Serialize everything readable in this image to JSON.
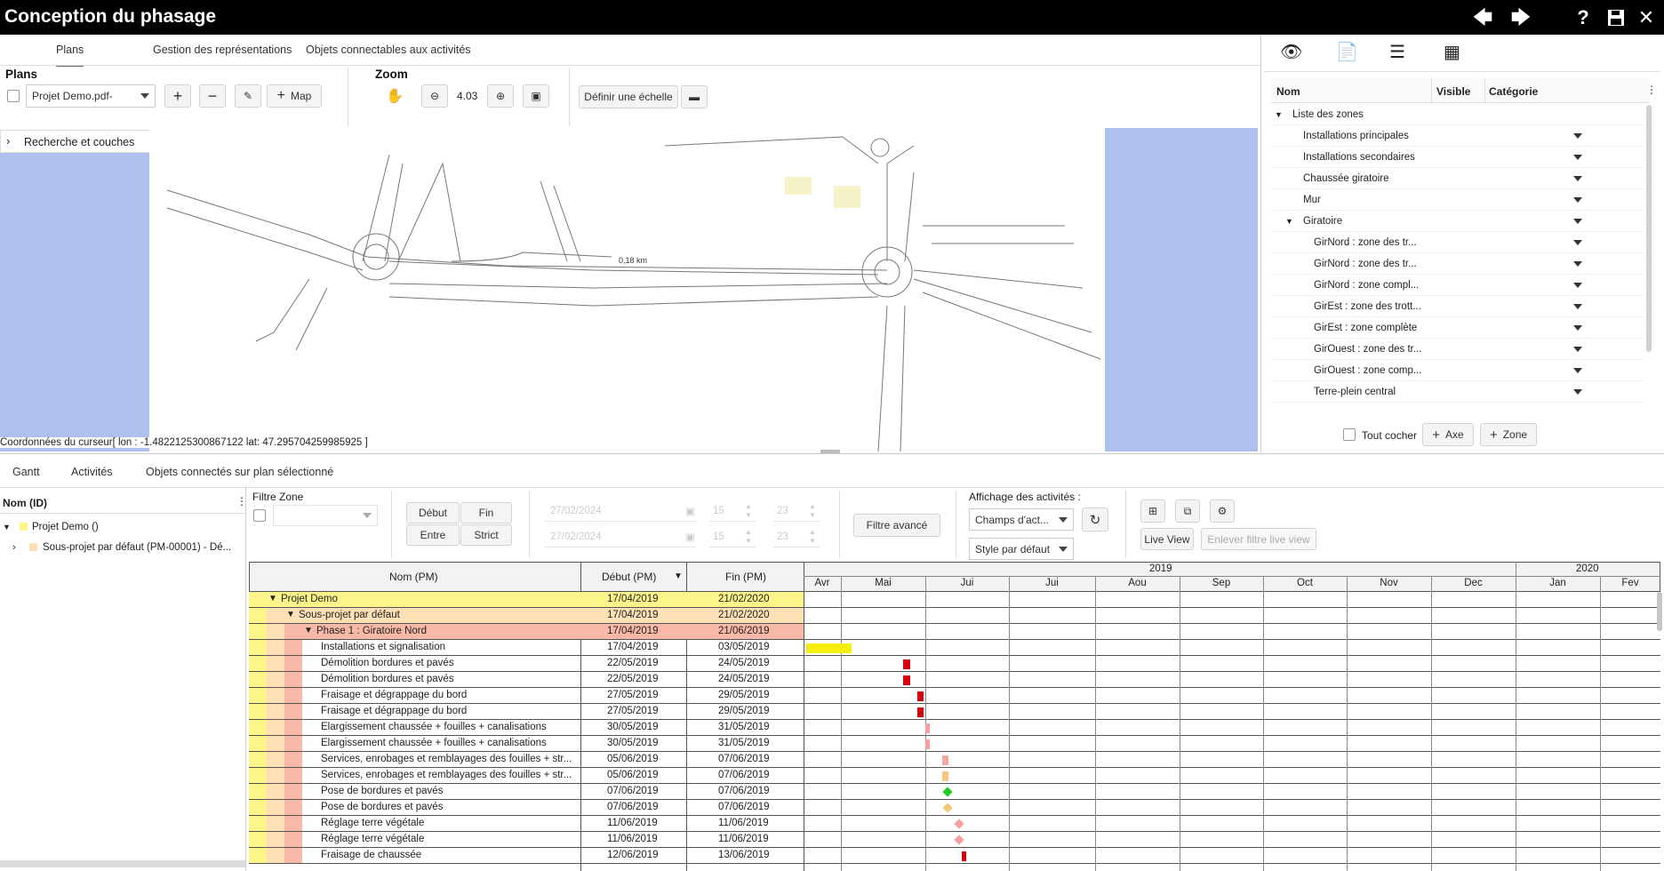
{
  "app": {
    "title": "Conception du phasage"
  },
  "top_tabs": [
    "Plans",
    "Gestion des représentations",
    "Objets connectables aux activités"
  ],
  "plans": {
    "label": "Plans",
    "plan_select": "Projet Demo.pdf-",
    "map_button": "Map",
    "search_layers": "Recherche et couches",
    "cursor_coords": "Coordonnées du curseur[ lon : -1.4822125300867122 lat: 47.295704259985925 ]"
  },
  "zoom": {
    "label": "Zoom",
    "value": "4.03",
    "define_scale": "Définir une échelle"
  },
  "map": {
    "distance_label": "0,18 km"
  },
  "zones_panel": {
    "columns": [
      "Nom",
      "Visible",
      "Catégorie"
    ],
    "root": "Liste des zones",
    "items": [
      {
        "label": "Installations principales",
        "indent": 1
      },
      {
        "label": "Installations secondaires",
        "indent": 1
      },
      {
        "label": "Chaussée giratoire",
        "indent": 1
      },
      {
        "label": "Mur",
        "indent": 1
      },
      {
        "label": "Giratoire",
        "indent": 1,
        "expanded": true
      },
      {
        "label": "GirNord : zone des tr...",
        "indent": 2
      },
      {
        "label": "GirNord : zone des tr...",
        "indent": 2
      },
      {
        "label": "GirNord : zone compl...",
        "indent": 2
      },
      {
        "label": "GirEst : zone des trott...",
        "indent": 2
      },
      {
        "label": "GirEst : zone complète",
        "indent": 2
      },
      {
        "label": "GirOuest : zone des tr...",
        "indent": 2
      },
      {
        "label": "GirOuest : zone comp...",
        "indent": 2
      },
      {
        "label": "Terre-plein central",
        "indent": 2
      }
    ],
    "check_all": "Tout cocher",
    "add_axis": "Axe",
    "add_zone": "Zone"
  },
  "bottom_tabs": [
    "Gantt",
    "Activités",
    "Objets connectés sur plan sélectionné"
  ],
  "tree": {
    "header": "Nom (ID)",
    "items": [
      "Projet Demo ()",
      "Sous-projet par défaut (PM-00001) - Dé..."
    ]
  },
  "filters": {
    "zone_label": "Filtre Zone",
    "debut": "Début",
    "fin": "Fin",
    "entre": "Entre",
    "strict": "Strict",
    "date1": "27/02/2024",
    "date2": "27/02/2024",
    "h1": "15",
    "m1": "23",
    "h2": "15",
    "m2": "23",
    "advanced": "Filtre avancé",
    "display_label": "Affichage des activités :",
    "fields_select": "Champs d'act...",
    "style_select": "Style par défaut",
    "live_view": "Live View",
    "remove_live": "Enlever filtre live view"
  },
  "gantt": {
    "headers": [
      "Nom (PM)",
      "Début (PM)",
      "Fin (PM)"
    ],
    "years": [
      "2019",
      "2020"
    ],
    "months": [
      "Avr",
      "Mai",
      "Jui",
      "Jui",
      "Aou",
      "Sep",
      "Oct",
      "Nov",
      "Dec",
      "Jan",
      "Fev"
    ],
    "rows": [
      {
        "name": "Projet Demo",
        "start": "17/04/2019",
        "end": "21/02/2020",
        "level": 0,
        "color": "#fdf58a"
      },
      {
        "name": "Sous-projet par défaut",
        "start": "17/04/2019",
        "end": "21/02/2020",
        "level": 1,
        "color": "#fde0b4"
      },
      {
        "name": "Phase 1 : Giratoire Nord",
        "start": "17/04/2019",
        "end": "21/06/2019",
        "level": 2,
        "color": "#f8b8a8"
      },
      {
        "name": "Installations et signalisation",
        "start": "17/04/2019",
        "end": "03/05/2019",
        "level": 3,
        "bar": "#f5ee0a"
      },
      {
        "name": "Démolition bordures et pavés",
        "start": "22/05/2019",
        "end": "24/05/2019",
        "level": 3,
        "bar": "#d8000f"
      },
      {
        "name": "Démolition bordures et pavés",
        "start": "22/05/2019",
        "end": "24/05/2019",
        "level": 3,
        "bar": "#d8000f"
      },
      {
        "name": "Fraisage et dégrappage du bord",
        "start": "27/05/2019",
        "end": "29/05/2019",
        "level": 3,
        "bar": "#d8000f"
      },
      {
        "name": "Fraisage et dégrappage du bord",
        "start": "27/05/2019",
        "end": "29/05/2019",
        "level": 3,
        "bar": "#d8000f"
      },
      {
        "name": "Elargissement chaussée + fouilles + canalisations",
        "start": "30/05/2019",
        "end": "31/05/2019",
        "level": 3,
        "bar": "#f4a0a0"
      },
      {
        "name": "Elargissement chaussée + fouilles + canalisations",
        "start": "30/05/2019",
        "end": "31/05/2019",
        "level": 3,
        "bar": "#f4a0a0"
      },
      {
        "name": "Services, enrobages et remblayages des fouilles + str...",
        "start": "05/06/2019",
        "end": "07/06/2019",
        "level": 3,
        "bar": "#f4a8a0"
      },
      {
        "name": "Services, enrobages et remblayages des fouilles + str...",
        "start": "05/06/2019",
        "end": "07/06/2019",
        "level": 3,
        "bar": "#f5c77a"
      },
      {
        "name": "Pose de bordures et pavés",
        "start": "07/06/2019",
        "end": "07/06/2019",
        "level": 3,
        "milestone": "#22cc22"
      },
      {
        "name": "Pose de bordures et pavés",
        "start": "07/06/2019",
        "end": "07/06/2019",
        "level": 3,
        "milestone": "#f5c77a"
      },
      {
        "name": "Réglage terre végétale",
        "start": "11/06/2019",
        "end": "11/06/2019",
        "level": 3,
        "milestone": "#f4a0a0"
      },
      {
        "name": "Réglage terre végétale",
        "start": "11/06/2019",
        "end": "11/06/2019",
        "level": 3,
        "milestone": "#f4a0a0"
      },
      {
        "name": "Fraisage de chaussée",
        "start": "12/06/2019",
        "end": "13/06/2019",
        "level": 3,
        "bar": "#d8000f"
      }
    ]
  }
}
